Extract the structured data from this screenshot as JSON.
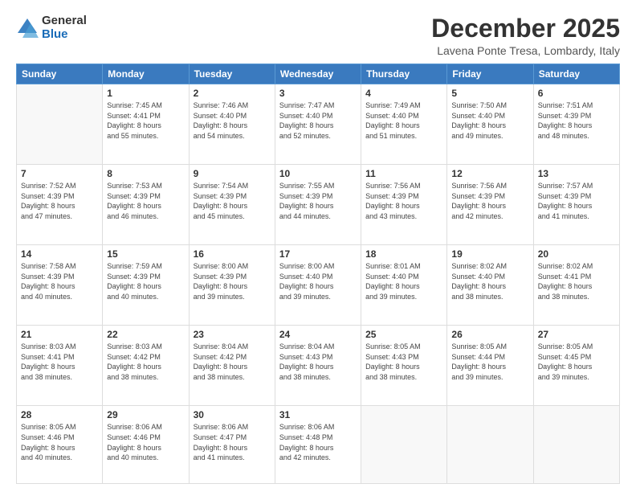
{
  "logo": {
    "general": "General",
    "blue": "Blue"
  },
  "header": {
    "month": "December 2025",
    "location": "Lavena Ponte Tresa, Lombardy, Italy"
  },
  "weekdays": [
    "Sunday",
    "Monday",
    "Tuesday",
    "Wednesday",
    "Thursday",
    "Friday",
    "Saturday"
  ],
  "weeks": [
    [
      {
        "day": "",
        "info": ""
      },
      {
        "day": "1",
        "info": "Sunrise: 7:45 AM\nSunset: 4:41 PM\nDaylight: 8 hours\nand 55 minutes."
      },
      {
        "day": "2",
        "info": "Sunrise: 7:46 AM\nSunset: 4:40 PM\nDaylight: 8 hours\nand 54 minutes."
      },
      {
        "day": "3",
        "info": "Sunrise: 7:47 AM\nSunset: 4:40 PM\nDaylight: 8 hours\nand 52 minutes."
      },
      {
        "day": "4",
        "info": "Sunrise: 7:49 AM\nSunset: 4:40 PM\nDaylight: 8 hours\nand 51 minutes."
      },
      {
        "day": "5",
        "info": "Sunrise: 7:50 AM\nSunset: 4:40 PM\nDaylight: 8 hours\nand 49 minutes."
      },
      {
        "day": "6",
        "info": "Sunrise: 7:51 AM\nSunset: 4:39 PM\nDaylight: 8 hours\nand 48 minutes."
      }
    ],
    [
      {
        "day": "7",
        "info": "Sunrise: 7:52 AM\nSunset: 4:39 PM\nDaylight: 8 hours\nand 47 minutes."
      },
      {
        "day": "8",
        "info": "Sunrise: 7:53 AM\nSunset: 4:39 PM\nDaylight: 8 hours\nand 46 minutes."
      },
      {
        "day": "9",
        "info": "Sunrise: 7:54 AM\nSunset: 4:39 PM\nDaylight: 8 hours\nand 45 minutes."
      },
      {
        "day": "10",
        "info": "Sunrise: 7:55 AM\nSunset: 4:39 PM\nDaylight: 8 hours\nand 44 minutes."
      },
      {
        "day": "11",
        "info": "Sunrise: 7:56 AM\nSunset: 4:39 PM\nDaylight: 8 hours\nand 43 minutes."
      },
      {
        "day": "12",
        "info": "Sunrise: 7:56 AM\nSunset: 4:39 PM\nDaylight: 8 hours\nand 42 minutes."
      },
      {
        "day": "13",
        "info": "Sunrise: 7:57 AM\nSunset: 4:39 PM\nDaylight: 8 hours\nand 41 minutes."
      }
    ],
    [
      {
        "day": "14",
        "info": "Sunrise: 7:58 AM\nSunset: 4:39 PM\nDaylight: 8 hours\nand 40 minutes."
      },
      {
        "day": "15",
        "info": "Sunrise: 7:59 AM\nSunset: 4:39 PM\nDaylight: 8 hours\nand 40 minutes."
      },
      {
        "day": "16",
        "info": "Sunrise: 8:00 AM\nSunset: 4:39 PM\nDaylight: 8 hours\nand 39 minutes."
      },
      {
        "day": "17",
        "info": "Sunrise: 8:00 AM\nSunset: 4:40 PM\nDaylight: 8 hours\nand 39 minutes."
      },
      {
        "day": "18",
        "info": "Sunrise: 8:01 AM\nSunset: 4:40 PM\nDaylight: 8 hours\nand 39 minutes."
      },
      {
        "day": "19",
        "info": "Sunrise: 8:02 AM\nSunset: 4:40 PM\nDaylight: 8 hours\nand 38 minutes."
      },
      {
        "day": "20",
        "info": "Sunrise: 8:02 AM\nSunset: 4:41 PM\nDaylight: 8 hours\nand 38 minutes."
      }
    ],
    [
      {
        "day": "21",
        "info": "Sunrise: 8:03 AM\nSunset: 4:41 PM\nDaylight: 8 hours\nand 38 minutes."
      },
      {
        "day": "22",
        "info": "Sunrise: 8:03 AM\nSunset: 4:42 PM\nDaylight: 8 hours\nand 38 minutes."
      },
      {
        "day": "23",
        "info": "Sunrise: 8:04 AM\nSunset: 4:42 PM\nDaylight: 8 hours\nand 38 minutes."
      },
      {
        "day": "24",
        "info": "Sunrise: 8:04 AM\nSunset: 4:43 PM\nDaylight: 8 hours\nand 38 minutes."
      },
      {
        "day": "25",
        "info": "Sunrise: 8:05 AM\nSunset: 4:43 PM\nDaylight: 8 hours\nand 38 minutes."
      },
      {
        "day": "26",
        "info": "Sunrise: 8:05 AM\nSunset: 4:44 PM\nDaylight: 8 hours\nand 39 minutes."
      },
      {
        "day": "27",
        "info": "Sunrise: 8:05 AM\nSunset: 4:45 PM\nDaylight: 8 hours\nand 39 minutes."
      }
    ],
    [
      {
        "day": "28",
        "info": "Sunrise: 8:05 AM\nSunset: 4:46 PM\nDaylight: 8 hours\nand 40 minutes."
      },
      {
        "day": "29",
        "info": "Sunrise: 8:06 AM\nSunset: 4:46 PM\nDaylight: 8 hours\nand 40 minutes."
      },
      {
        "day": "30",
        "info": "Sunrise: 8:06 AM\nSunset: 4:47 PM\nDaylight: 8 hours\nand 41 minutes."
      },
      {
        "day": "31",
        "info": "Sunrise: 8:06 AM\nSunset: 4:48 PM\nDaylight: 8 hours\nand 42 minutes."
      },
      {
        "day": "",
        "info": ""
      },
      {
        "day": "",
        "info": ""
      },
      {
        "day": "",
        "info": ""
      }
    ]
  ]
}
